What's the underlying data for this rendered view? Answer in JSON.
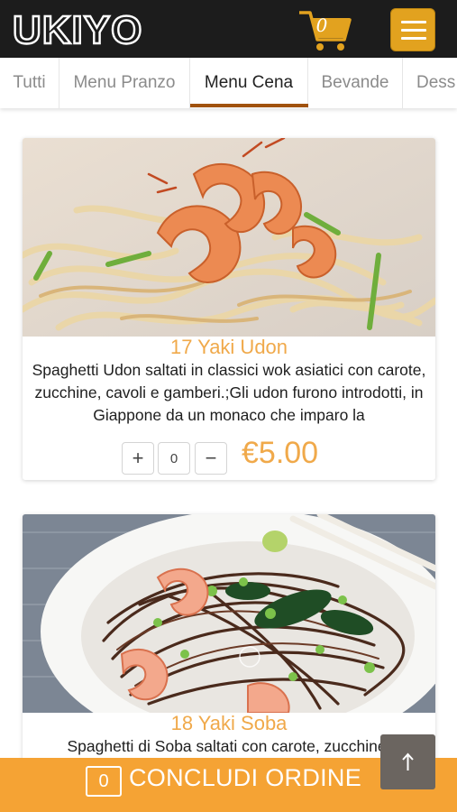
{
  "header": {
    "logo_text": "UKIYO",
    "cart_count": "0",
    "menu_icon": "hamburger-icon",
    "cart_icon": "shopping-cart-icon"
  },
  "tabs": [
    {
      "label": "Tutti",
      "active": false
    },
    {
      "label": "Menu Pranzo",
      "active": false
    },
    {
      "label": "Menu Cena",
      "active": true
    },
    {
      "label": "Bevande",
      "active": false
    },
    {
      "label": "Dess",
      "active": false
    }
  ],
  "products": [
    {
      "title": "17 Yaki Udon",
      "description": "Spaghetti Udon saltati in classici wok asiatici con carote, zucchine, cavoli e gamberi.;Gli udon furono introdotti, in Giappone da un monaco che imparo la",
      "quantity": "0",
      "price": "€5.00",
      "plus_label": "+",
      "minus_label": "−"
    },
    {
      "title": "18 Yaki Soba",
      "description": "Spaghetti di Soba saltati con carote, zucchine,"
    }
  ],
  "order_bar": {
    "count": "0",
    "label": "CONCLUDI ORDINE"
  },
  "scroll_top_icon": "arrow-up-icon",
  "colors": {
    "header_bg": "#1c1c1c",
    "accent_orange": "#f5a334",
    "menu_button": "#e2a21f",
    "tab_underline": "#a0520d",
    "title_orange": "#f0a94a"
  }
}
